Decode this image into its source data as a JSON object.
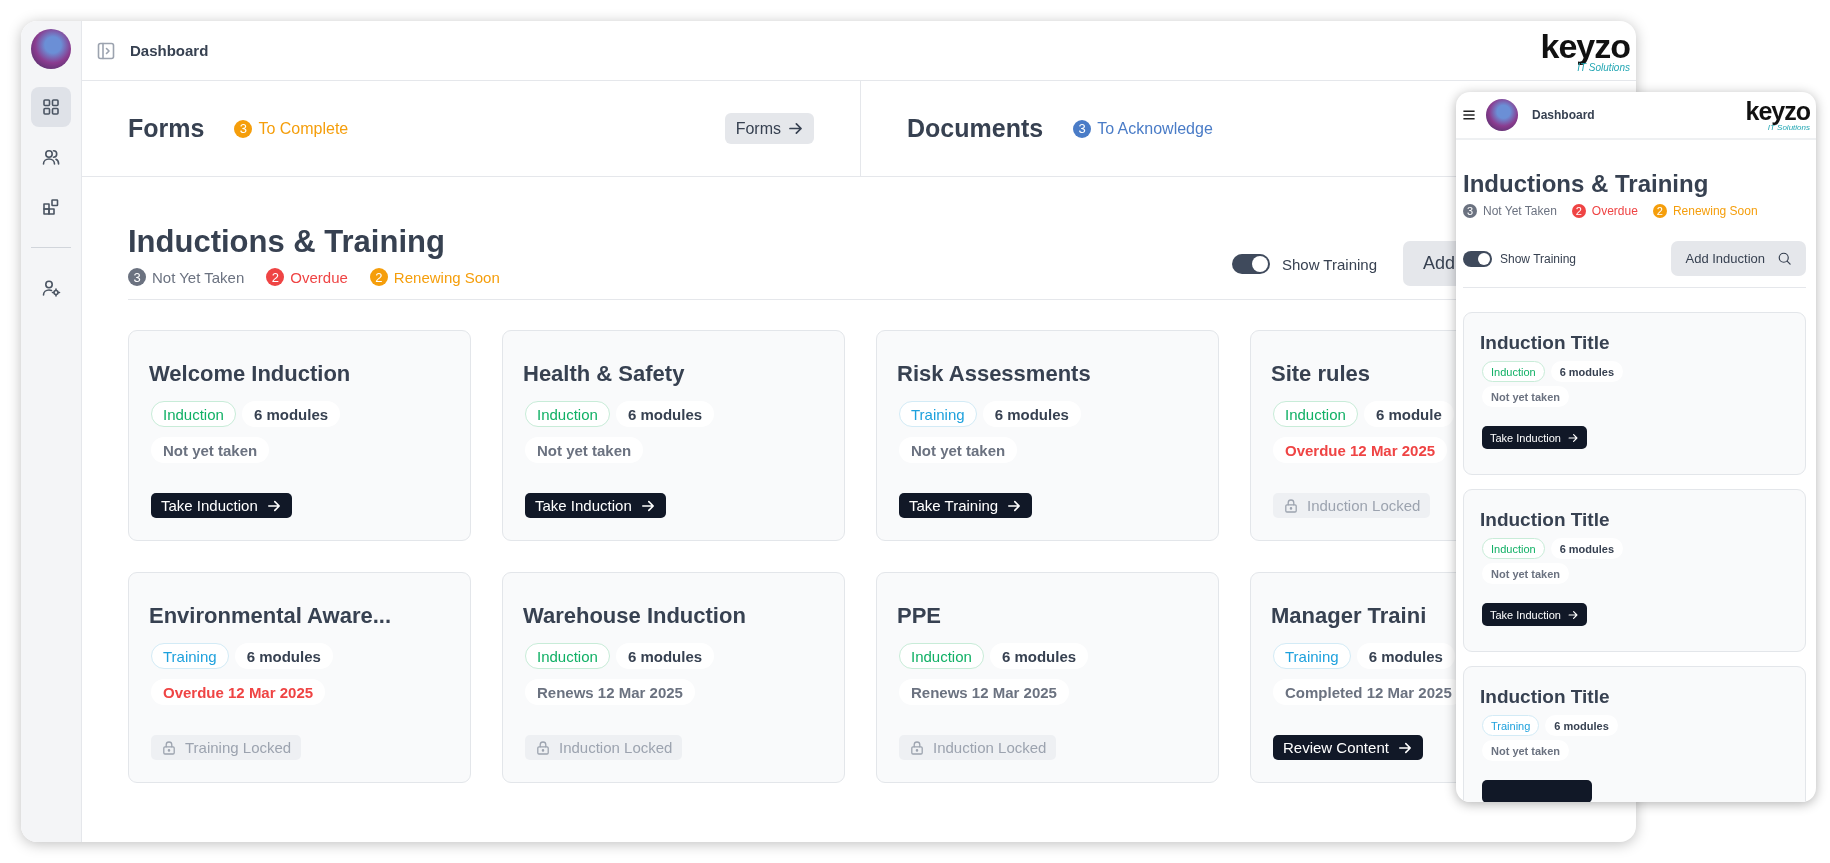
{
  "desktop": {
    "header": {
      "title": "Dashboard"
    },
    "logo": {
      "name": "keyzo",
      "tagline": "IT Solutions"
    },
    "sidebar": {
      "items": [
        {
          "kind": "grid",
          "selected": true
        },
        {
          "kind": "users",
          "selected": false
        },
        {
          "kind": "blocks",
          "selected": false
        },
        {
          "kind": "divider"
        },
        {
          "kind": "usergear",
          "selected": false
        }
      ]
    },
    "summary": [
      {
        "title": "Forms",
        "count": "3",
        "label": "To Complete",
        "color": "#f59e0b",
        "button": "Forms"
      },
      {
        "title": "Documents",
        "count": "3",
        "label": "To Acknowledge",
        "color": "#4a7cc7"
      }
    ],
    "section": {
      "title": "Inductions & Training",
      "stats": [
        {
          "count": "3",
          "label": "Not Yet Taken",
          "color": "#6b7280"
        },
        {
          "count": "2",
          "label": "Overdue",
          "color": "#ef4444"
        },
        {
          "count": "2",
          "label": "Renewing Soon",
          "color": "#f59e0b"
        }
      ],
      "toggle": {
        "label": "Show Training",
        "on": true
      },
      "add_button": "Add"
    },
    "cards": [
      {
        "title": "Welcome Induction",
        "kind": "induction",
        "type_label": "Induction",
        "modules": "6 modules",
        "status": "Not yet taken",
        "overdue": false,
        "action": {
          "kind": "primary",
          "label": "Take Induction"
        }
      },
      {
        "title": "Health & Safety",
        "kind": "induction",
        "type_label": "Induction",
        "modules": "6 modules",
        "status": "Not yet taken",
        "overdue": false,
        "action": {
          "kind": "primary",
          "label": "Take Induction"
        }
      },
      {
        "title": "Risk Assessments",
        "kind": "training",
        "type_label": "Training",
        "modules": "6 modules",
        "status": "Not yet taken",
        "overdue": false,
        "action": {
          "kind": "primary",
          "label": "Take Training"
        }
      },
      {
        "title": "Site rules",
        "kind": "induction",
        "type_label": "Induction",
        "modules": "6 module",
        "status": "Overdue 12 Mar 2025",
        "overdue": true,
        "action": {
          "kind": "locked",
          "label": "Induction Locked"
        }
      },
      {
        "title": "Environmental Aware...",
        "kind": "training",
        "type_label": "Training",
        "modules": "6 modules",
        "status": "Overdue 12 Mar 2025",
        "overdue": true,
        "action": {
          "kind": "locked",
          "label": "Training Locked"
        }
      },
      {
        "title": "Warehouse Induction",
        "kind": "induction",
        "type_label": "Induction",
        "modules": "6 modules",
        "status": "Renews 12 Mar 2025",
        "overdue": false,
        "action": {
          "kind": "locked",
          "label": "Induction Locked"
        }
      },
      {
        "title": "PPE",
        "kind": "induction",
        "type_label": "Induction",
        "modules": "6 modules",
        "status": "Renews 12 Mar 2025",
        "overdue": false,
        "action": {
          "kind": "locked",
          "label": "Induction Locked"
        }
      },
      {
        "title": "Manager Traini",
        "kind": "training",
        "type_label": "Training",
        "modules": "6 modules",
        "status": "Completed 12 Mar 2025",
        "overdue": false,
        "action": {
          "kind": "primary",
          "label": "Review Content"
        }
      }
    ]
  },
  "mobile": {
    "header": {
      "title": "Dashboard"
    },
    "logo": {
      "name": "keyzo",
      "tagline": "IT Solutions"
    },
    "section": {
      "title": "Inductions & Training",
      "stats": [
        {
          "count": "3",
          "label": "Not Yet Taken",
          "color": "#6b7280"
        },
        {
          "count": "2",
          "label": "Overdue",
          "color": "#ef4444"
        },
        {
          "count": "2",
          "label": "Renewing Soon",
          "color": "#f59e0b"
        }
      ],
      "toggle": {
        "label": "Show Training",
        "on": true
      },
      "add_button": "Add Induction"
    },
    "cards": [
      {
        "title": "Induction Title",
        "kind": "induction",
        "type_label": "Induction",
        "modules": "6 modules",
        "status": "Not yet taken",
        "overdue": false,
        "action": {
          "kind": "primary",
          "label": "Take Induction"
        }
      },
      {
        "title": "Induction Title",
        "kind": "induction",
        "type_label": "Induction",
        "modules": "6 modules",
        "status": "Not yet taken",
        "overdue": false,
        "action": {
          "kind": "primary",
          "label": "Take Induction"
        }
      },
      {
        "title": "Induction Title",
        "kind": "training",
        "type_label": "Training",
        "modules": "6 modules",
        "status": "Not yet taken",
        "overdue": false,
        "action": {
          "kind": "primary"
        }
      }
    ]
  }
}
